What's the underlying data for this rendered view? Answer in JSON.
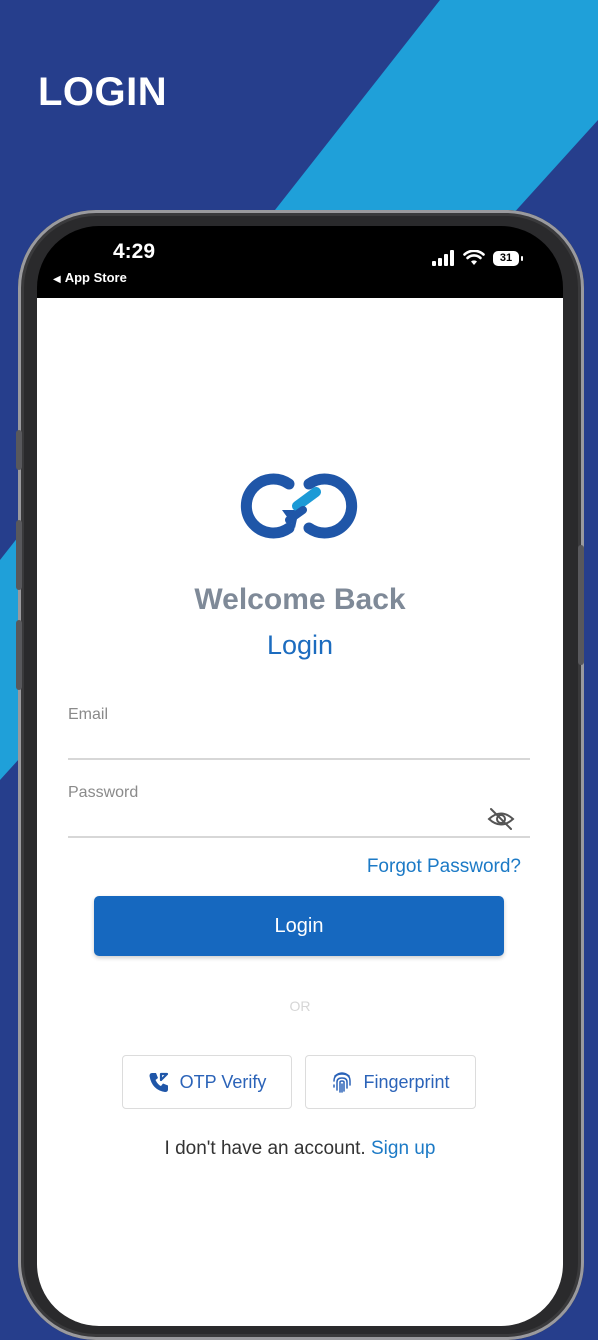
{
  "promo": {
    "title": "LOGIN"
  },
  "status_bar": {
    "time": "4:29",
    "back_label": "App Store",
    "battery": "31"
  },
  "login_screen": {
    "welcome": "Welcome Back",
    "subtitle": "Login",
    "email": {
      "label": "Email",
      "value": ""
    },
    "password": {
      "label": "Password",
      "value": ""
    },
    "forgot_password": "Forgot Password?",
    "login_button": "Login",
    "or_divider": "OR",
    "otp_button": "OTP Verify",
    "fingerprint_button": "Fingerprint",
    "signup_prompt": "I don't have an account.",
    "signup_link": "Sign up"
  },
  "colors": {
    "background_dark": "#263e8c",
    "background_light": "#1fa0d9",
    "primary": "#1668bf",
    "link": "#1c7ac6",
    "muted_title": "#7f8a98"
  },
  "icons": {
    "logo": "infinity-link-logo",
    "otp": "phone-verify-icon",
    "fingerprint": "fingerprint-icon",
    "password_toggle": "eye-slash-icon"
  }
}
